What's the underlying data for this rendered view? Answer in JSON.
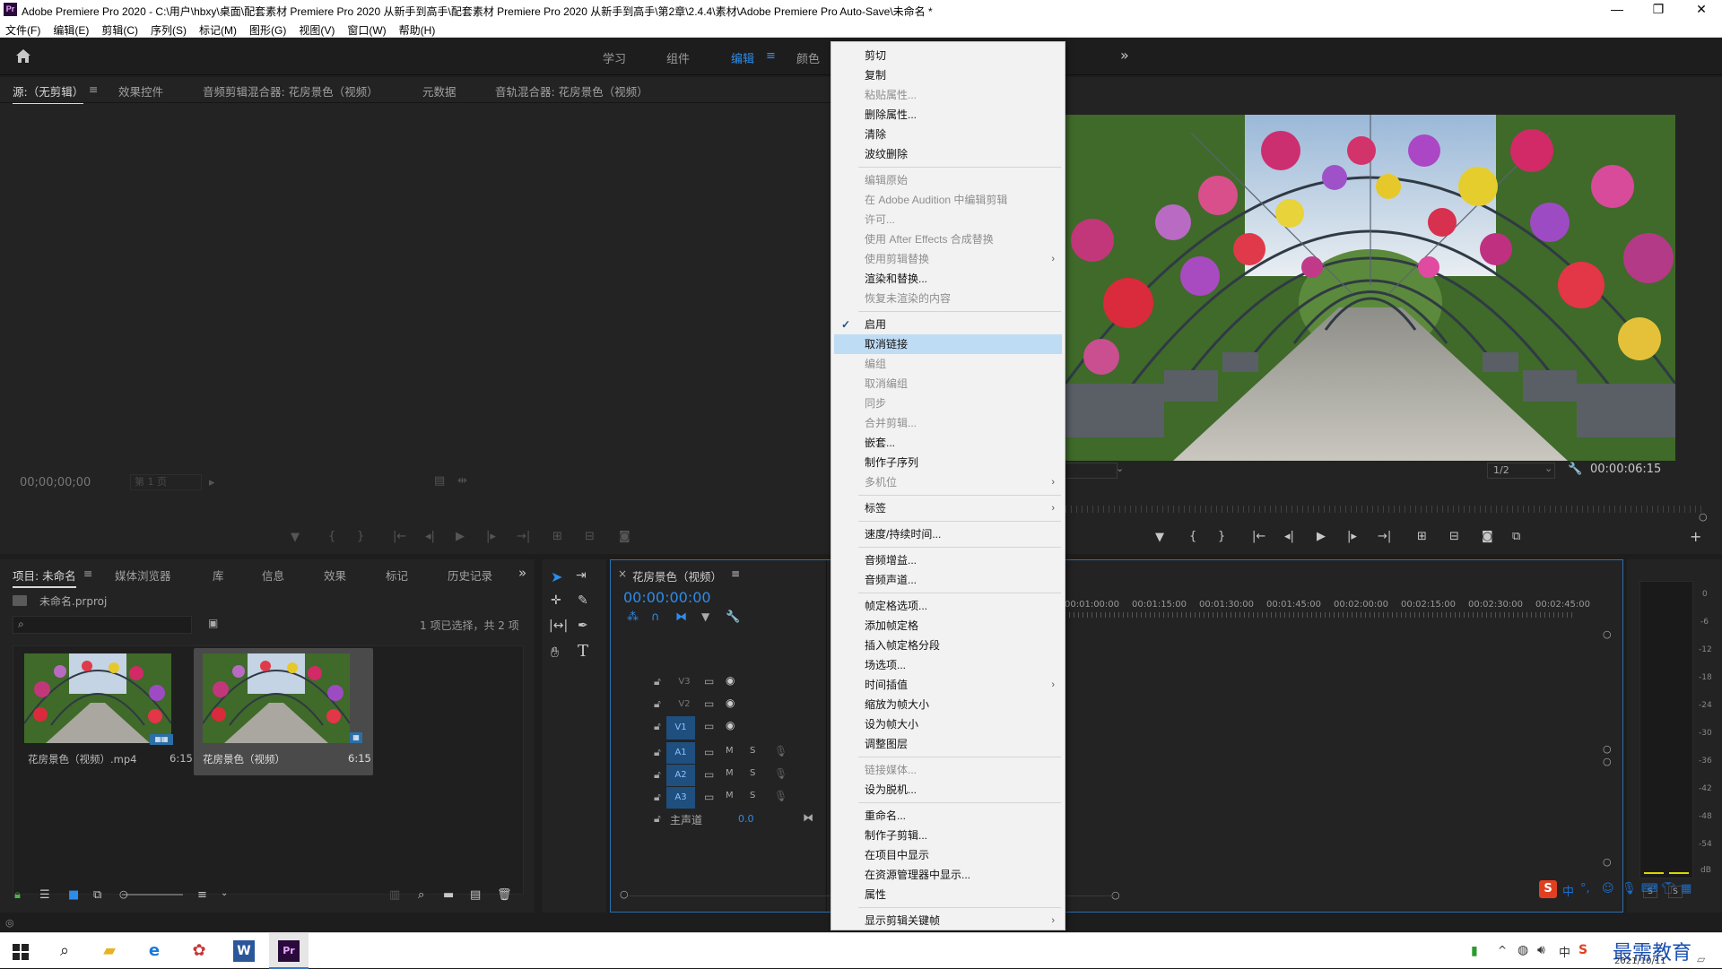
{
  "window": {
    "title": "Adobe Premiere Pro 2020 - C:\\用户\\hbxy\\桌面\\配套素材 Premiere Pro 2020 从新手到高手\\配套素材 Premiere Pro 2020 从新手到高手\\第2章\\2.4.4\\素材\\Adobe Premiere Pro Auto-Save\\未命名 *",
    "logo": "Pr",
    "minimize": "—",
    "maximize": "❐",
    "close": "✕"
  },
  "menubar": [
    "文件(F)",
    "编辑(E)",
    "剪辑(C)",
    "序列(S)",
    "标记(M)",
    "图形(G)",
    "视图(V)",
    "窗口(W)",
    "帮助(H)"
  ],
  "workspaces": {
    "tabs": [
      "学习",
      "组件",
      "编辑",
      "颜色"
    ],
    "active": "编辑",
    "menu_icon": "≡",
    "overflow": "»"
  },
  "source_panel": {
    "tabs": [
      "源:（无剪辑）",
      "效果控件",
      "音频剪辑混合器: 花房景色（视频）",
      "元数据",
      "音轨混合器: 花房景色（视频）"
    ],
    "menu_icon": "≡",
    "timecode": "00;00;00;00",
    "page": "第 1 页"
  },
  "program_panel": {
    "zoom": "1/2",
    "duration": "00:00:06:15"
  },
  "project_panel": {
    "tabs": [
      "项目: 未命名",
      "媒体浏览器",
      "库",
      "信息",
      "效果",
      "标记",
      "历史记录"
    ],
    "menu_icon": "≡",
    "overflow": "»",
    "file": "未命名.prproj",
    "selection": "1 项已选择，共 2 项",
    "items": [
      {
        "name": "花房景色（视频）.mp4",
        "duration": "6:15"
      },
      {
        "name": "花房景色（视频）",
        "duration": "6:15"
      }
    ]
  },
  "timeline": {
    "sequence": "花房景色（视频）",
    "close": "×",
    "menu_icon": "≡",
    "timecode": "00:00:00:00",
    "ruler": [
      "00:01:00:00",
      "00:01:15:00",
      "00:01:30:00",
      "00:01:45:00",
      "00:02:00:00",
      "00:02:15:00",
      "00:02:30:00",
      "00:02:45:00"
    ],
    "video_tracks": [
      "V3",
      "V2",
      "V1"
    ],
    "audio_tracks": [
      "A1",
      "A2",
      "A3"
    ],
    "mute": "M",
    "solo": "S",
    "master": "主声道",
    "master_value": "0.0"
  },
  "audio_meter": {
    "scale": [
      "0",
      "-6",
      "-12",
      "-18",
      "-24",
      "-30",
      "-36",
      "-42",
      "-48",
      "-54",
      "dB"
    ],
    "solo": [
      "S",
      "S"
    ]
  },
  "context_menu": {
    "items": [
      {
        "label": "剪切",
        "state": "enabled",
        "submenu": false
      },
      {
        "label": "复制",
        "state": "enabled",
        "submenu": false
      },
      {
        "label": "粘贴属性...",
        "state": "disabled",
        "submenu": false
      },
      {
        "label": "删除属性...",
        "state": "enabled",
        "submenu": false
      },
      {
        "label": "清除",
        "state": "enabled",
        "submenu": false
      },
      {
        "label": "波纹删除",
        "state": "enabled",
        "submenu": false
      },
      {
        "label": "---"
      },
      {
        "label": "编辑原始",
        "state": "disabled",
        "submenu": false
      },
      {
        "label": "在 Adobe Audition 中编辑剪辑",
        "state": "disabled",
        "submenu": false
      },
      {
        "label": "许可...",
        "state": "disabled",
        "submenu": false
      },
      {
        "label": "使用 After Effects 合成替换",
        "state": "disabled",
        "submenu": false
      },
      {
        "label": "使用剪辑替换",
        "state": "disabled",
        "submenu": true
      },
      {
        "label": "渲染和替换...",
        "state": "enabled",
        "submenu": false
      },
      {
        "label": "恢复未渲染的内容",
        "state": "disabled",
        "submenu": false
      },
      {
        "label": "---"
      },
      {
        "label": "启用",
        "state": "enabled",
        "submenu": false,
        "checked": true
      },
      {
        "label": "取消链接",
        "state": "highlighted",
        "submenu": false
      },
      {
        "label": "编组",
        "state": "disabled",
        "submenu": false
      },
      {
        "label": "取消编组",
        "state": "disabled",
        "submenu": false
      },
      {
        "label": "同步",
        "state": "disabled",
        "submenu": false
      },
      {
        "label": "合并剪辑...",
        "state": "disabled",
        "submenu": false
      },
      {
        "label": "嵌套...",
        "state": "enabled",
        "submenu": false
      },
      {
        "label": "制作子序列",
        "state": "enabled",
        "submenu": false
      },
      {
        "label": "多机位",
        "state": "disabled",
        "submenu": true
      },
      {
        "label": "---"
      },
      {
        "label": "标签",
        "state": "enabled",
        "submenu": true
      },
      {
        "label": "---"
      },
      {
        "label": "速度/持续时间...",
        "state": "enabled",
        "submenu": false
      },
      {
        "label": "---"
      },
      {
        "label": "音频增益...",
        "state": "enabled",
        "submenu": false
      },
      {
        "label": "音频声道...",
        "state": "enabled",
        "submenu": false
      },
      {
        "label": "---"
      },
      {
        "label": "帧定格选项...",
        "state": "enabled",
        "submenu": false
      },
      {
        "label": "添加帧定格",
        "state": "enabled",
        "submenu": false
      },
      {
        "label": "插入帧定格分段",
        "state": "enabled",
        "submenu": false
      },
      {
        "label": "场选项...",
        "state": "enabled",
        "submenu": false
      },
      {
        "label": "时间插值",
        "state": "enabled",
        "submenu": true
      },
      {
        "label": "缩放为帧大小",
        "state": "enabled",
        "submenu": false
      },
      {
        "label": "设为帧大小",
        "state": "enabled",
        "submenu": false
      },
      {
        "label": "调整图层",
        "state": "enabled",
        "submenu": false
      },
      {
        "label": "---"
      },
      {
        "label": "链接媒体...",
        "state": "disabled",
        "submenu": false
      },
      {
        "label": "设为脱机...",
        "state": "enabled",
        "submenu": false
      },
      {
        "label": "---"
      },
      {
        "label": "重命名...",
        "state": "enabled",
        "submenu": false
      },
      {
        "label": "制作子剪辑...",
        "state": "enabled",
        "submenu": false
      },
      {
        "label": "在项目中显示",
        "state": "enabled",
        "submenu": false
      },
      {
        "label": "在资源管理器中显示...",
        "state": "enabled",
        "submenu": false
      },
      {
        "label": "属性",
        "state": "enabled",
        "submenu": false
      },
      {
        "label": "---"
      },
      {
        "label": "显示剪辑关键帧",
        "state": "enabled",
        "submenu": true
      }
    ],
    "check_glyph": "✓",
    "arrow_glyph": "›"
  },
  "taskbar": {
    "date": "2021/10/11",
    "watermark": "最需教育",
    "ime": "中",
    "word_label": "W",
    "pr_label": "Pr"
  }
}
